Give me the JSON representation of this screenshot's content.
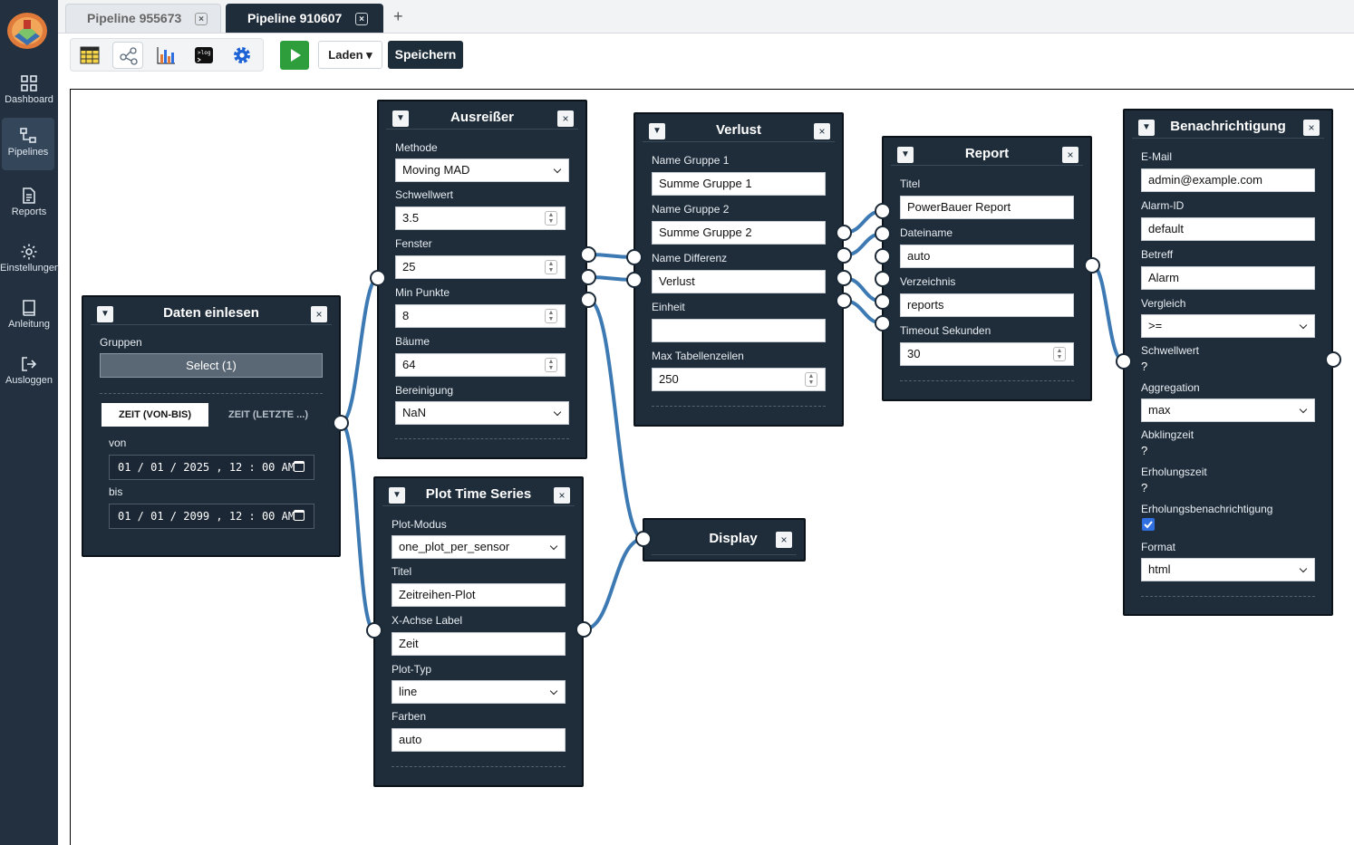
{
  "tabs": [
    {
      "label": "Pipeline 955673"
    },
    {
      "label": "Pipeline 910607"
    }
  ],
  "tab_close": "×",
  "tab_add": "+",
  "nav": {
    "dashboard": "Dashboard",
    "pipelines": "Pipelines",
    "reports": "Reports",
    "settings": "Einstellungen",
    "manual": "Anleitung",
    "logout": "Ausloggen"
  },
  "toolbar": {
    "load_label": "Laden ▾",
    "save_label": "Speichern",
    "terminal_text": ">log"
  },
  "node_controls": {
    "collapse": "▼",
    "close": "×"
  },
  "nodes": {
    "daten": {
      "title": "Daten einlesen",
      "groups_label": "Gruppen",
      "groups_button": "Select (1)",
      "tab_range": "ZEIT (VON-BIS)",
      "tab_last": "ZEIT (LETZTE ...)",
      "from_label": "von",
      "from_value": "01 / 01 / 2025 ,  12 : 00  AM",
      "to_label": "bis",
      "to_value": "01 / 01 / 2099 ,  12 : 00  AM"
    },
    "ausreisser": {
      "title": "Ausreißer",
      "method_label": "Methode",
      "method_value": "Moving MAD",
      "threshold_label": "Schwellwert",
      "threshold_value": "3.5",
      "window_label": "Fenster",
      "window_value": "25",
      "minpoints_label": "Min Punkte",
      "minpoints_value": "8",
      "trees_label": "Bäume",
      "trees_value": "64",
      "cleanup_label": "Bereinigung",
      "cleanup_value": "NaN"
    },
    "plot": {
      "title": "Plot Time Series",
      "mode_label": "Plot-Modus",
      "mode_value": "one_plot_per_sensor",
      "title_label": "Titel",
      "title_value": "Zeitreihen-Plot",
      "xaxis_label": "X-Achse Label",
      "xaxis_value": "Zeit",
      "type_label": "Plot-Typ",
      "type_value": "line",
      "colors_label": "Farben",
      "colors_value": "auto"
    },
    "verlust": {
      "title": "Verlust",
      "g1_label": "Name Gruppe 1",
      "g1_value": "Summe Gruppe 1",
      "g2_label": "Name Gruppe 2",
      "g2_value": "Summe Gruppe 2",
      "diff_label": "Name Differenz",
      "diff_value": "Verlust",
      "unit_label": "Einheit",
      "unit_value": "",
      "maxrows_label": "Max Tabellenzeilen",
      "maxrows_value": "250"
    },
    "display": {
      "title": "Display"
    },
    "report": {
      "title": "Report",
      "title_label": "Titel",
      "title_value": "PowerBauer Report",
      "filename_label": "Dateiname",
      "filename_value": "auto",
      "dir_label": "Verzeichnis",
      "dir_value": "reports",
      "timeout_label": "Timeout Sekunden",
      "timeout_value": "30"
    },
    "notify": {
      "title": "Benachrichtigung",
      "email_label": "E-Mail",
      "email_value": "admin@example.com",
      "alarm_label": "Alarm-ID",
      "alarm_value": "default",
      "subject_label": "Betreff",
      "subject_value": "Alarm",
      "compare_label": "Vergleich",
      "compare_value": ">=",
      "threshold_label": "Schwellwert",
      "threshold_value": "?",
      "agg_label": "Aggregation",
      "agg_value": "max",
      "cooldown_label": "Abklingzeit",
      "cooldown_value": "?",
      "recovery_label": "Erholungszeit",
      "recovery_value": "?",
      "recovery_notify_label": "Erholungsbenachrichtigung",
      "recovery_notify_checked": true,
      "format_label": "Format",
      "format_value": "html"
    }
  },
  "colors": {
    "sidebar": "#22303f",
    "node_bg": "#1f2d3b",
    "wire": "#3d7ab3",
    "run": "#2e9e3c",
    "save": "#1e2d3a"
  }
}
